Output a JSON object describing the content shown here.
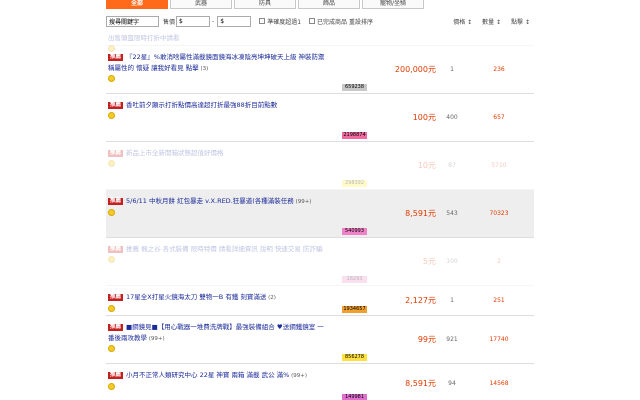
{
  "tabs": [
    {
      "label": "全部",
      "active": true
    },
    {
      "label": "武器",
      "active": false
    },
    {
      "label": "防具",
      "active": false
    },
    {
      "label": "飾品",
      "active": false
    },
    {
      "label": "寵物/坐騎",
      "active": false
    }
  ],
  "filter": {
    "keyword_value": "搜尋關鍵字",
    "price_label": "售價",
    "price_min_value": "$",
    "price_max_value": "$",
    "dash": "-",
    "opt1": "準確度超過1",
    "opt2": "已完成商品",
    "reset": "重設排序",
    "sorts": [
      "價格 ↕",
      "數量 ↕",
      "點擊 ↕"
    ]
  },
  "rows": [
    {
      "title": "出售頭盔限時打折中請看",
      "badge": "",
      "count": "",
      "code": "",
      "price": "",
      "qty": "",
      "views": "",
      "faded": true,
      "shaded": false
    },
    {
      "title": "『22星』%敢消啥屬性滿載鏡面鏡海冰凍陰亮坤坤破天上級 神裝防禦稱屬性的 懷疑 讓我好看見 點擊",
      "badge": "推薦",
      "count": "(3)",
      "code": "659238",
      "price": "200,000元",
      "qty": "1",
      "views": "236",
      "faded": false,
      "shaded": false,
      "code_color": "#c8c8c8"
    },
    {
      "title": "香吐前夕顯示打折點價高達超打折最強88折目前點數",
      "badge": "推薦",
      "count": "",
      "code": "2198874",
      "price": "100元",
      "qty": "400",
      "views": "657",
      "faded": false,
      "shaded": false,
      "code_color": "#f06aa0"
    },
    {
      "title": "新品上市全新開箱狀態超值好價格",
      "badge": "推薦",
      "count": "",
      "code": "298392",
      "price": "10元",
      "qty": "87",
      "views": "5710",
      "faded": true,
      "shaded": false,
      "code_color": "#ffee44"
    },
    {
      "title": "5/6/11 中秋月餅 紅包暴走 v.X.RED.狂暴道(各種滿裝任務",
      "badge": "推薦",
      "count": "(99+)",
      "code": "540993",
      "price": "8,591元",
      "qty": "543",
      "views": "70323",
      "faded": false,
      "shaded": true,
      "code_color": "#f080c8"
    },
    {
      "title": "推薦 楓之谷 各式裝備 限時特價 請看詳細資訊 說明 快速交易 防詐騙",
      "badge": "推薦",
      "count": "",
      "code": "18293",
      "price": "5元",
      "qty": "100",
      "views": "2",
      "faded": true,
      "shaded": false,
      "code_color": "#f090c8"
    },
    {
      "title": "17星全X打星火鏡海太刀 雙物一B 有鐵 刻寶滿送",
      "badge": "推薦",
      "count": "(2)",
      "code": "1934657",
      "price": "2,127元",
      "qty": "1",
      "views": "251",
      "faded": false,
      "shaded": false,
      "code_color": "#f0a030"
    },
    {
      "title": "■鋼鏡見■【用心戰器一堆費洗牌戰】最強裝備組合 ♥送鋼鐵鏡室 一番後兩攻教學",
      "badge": "推薦",
      "count": "(99+)",
      "code": "856278",
      "price": "99元",
      "qty": "921",
      "views": "17740",
      "faded": false,
      "shaded": false,
      "code_color": "#ffe040"
    },
    {
      "title": "小月不正常人類研究中心 22星 神寶 兩箱 滿載 武公 滿%",
      "badge": "推薦",
      "count": "(99+)",
      "code": "149981",
      "price": "8,591元",
      "qty": "94",
      "views": "14568",
      "faded": false,
      "shaded": false,
      "code_color": "#e070d0"
    }
  ]
}
